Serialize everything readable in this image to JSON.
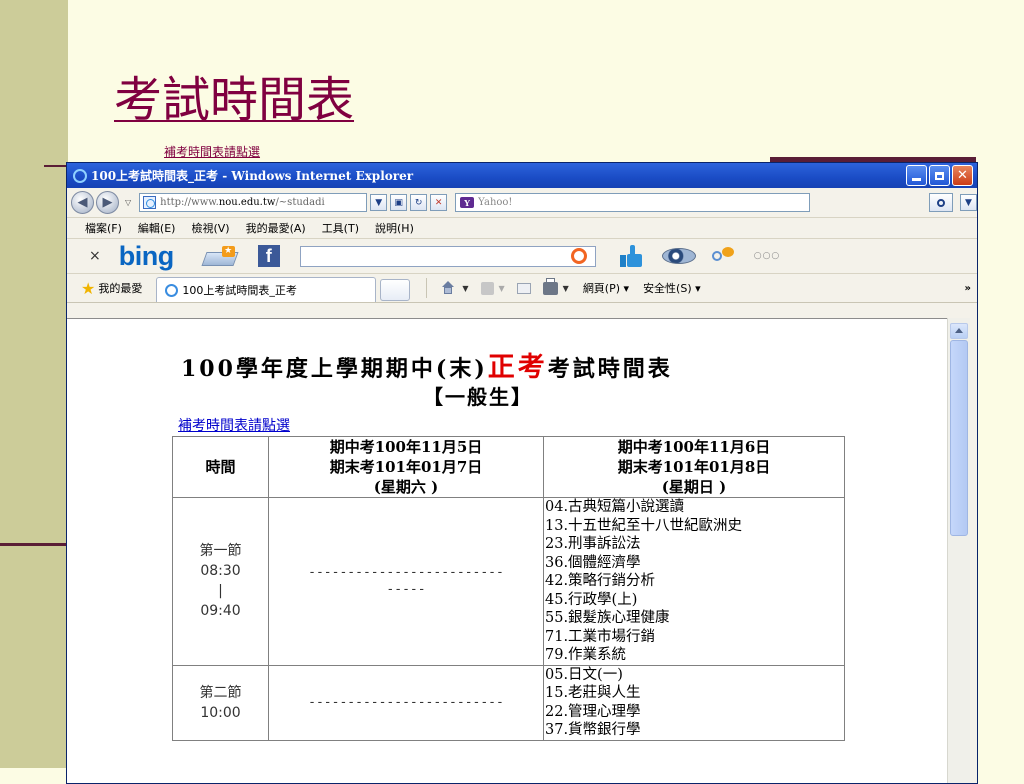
{
  "slide": {
    "title": "考試時間表",
    "link": "補考時間表請點選"
  },
  "window": {
    "title": "100上考試時間表_正考 - Windows Internet Explorer",
    "address_prefix": "http://www.",
    "address_host": "nou.edu.tw",
    "address_rest": "/~studadi",
    "search_placeholder": "Yahoo!"
  },
  "menu": [
    "檔案(F)",
    "編輯(E)",
    "檢視(V)",
    "我的最愛(A)",
    "工具(T)",
    "說明(H)"
  ],
  "bing": {
    "logo": "bing",
    "close": "×",
    "more": "○○○"
  },
  "favorites": {
    "label": "我的最愛",
    "tab_title": "100上考試時間表_正考",
    "page_menu": "網頁(P)",
    "safety_menu": "安全性(S)",
    "more": "»"
  },
  "doc": {
    "title_part1": "100學年度上學期期中(末)",
    "title_red": "正考",
    "title_part2": "考試時間表",
    "subtitle": "【一般生】",
    "link": "補考時間表請點選",
    "headers": {
      "time": "時間",
      "sat": [
        "期中考100年11月5日",
        "期末考101年01月7日",
        "(星期六 )"
      ],
      "sun": [
        "期中考100年11月6日",
        "期末考101年01月8日",
        "(星期日 )"
      ]
    },
    "rows": [
      {
        "period": "第一節",
        "start": "08:30",
        "sep": "|",
        "end": "09:40",
        "sat_line1": "-------------------------",
        "sat_line2": "-----",
        "sun": [
          "04.古典短篇小說選讀",
          "13.十五世紀至十八世紀歐洲史",
          "23.刑事訴訟法",
          "36.個體經濟學",
          "42.策略行銷分析",
          "45.行政學(上)",
          "55.銀髮族心理健康",
          "71.工業市場行銷",
          "79.作業系統"
        ]
      },
      {
        "period": "第二節",
        "start": "10:00",
        "sat_line1": "-------------------------",
        "sun": [
          "05.日文(一)",
          "15.老莊與人生",
          "22.管理心理學",
          "37.貨幣銀行學"
        ]
      }
    ]
  }
}
